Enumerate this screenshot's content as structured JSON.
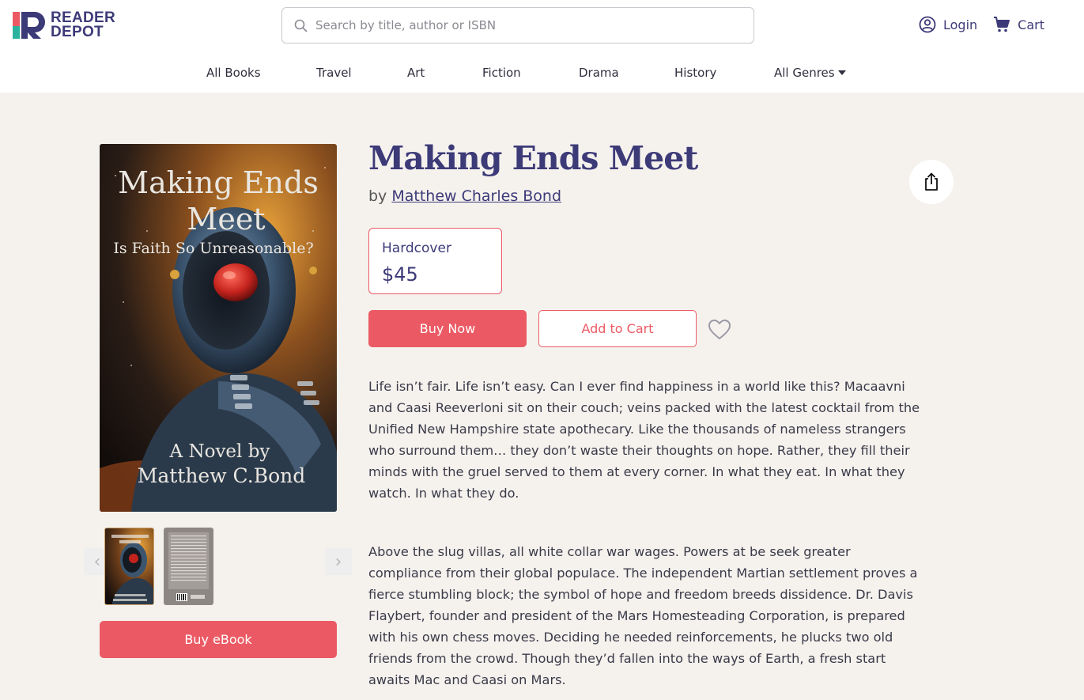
{
  "brand": {
    "line1": "READER",
    "line2": "DEPOT",
    "colors": {
      "primary": "#3d3a78",
      "accent": "#eb5a64",
      "green": "#2bb3a0"
    }
  },
  "search": {
    "placeholder": "Search by title, author or ISBN",
    "value": ""
  },
  "header_actions": {
    "login_label": "Login",
    "cart_label": "Cart"
  },
  "nav": {
    "items": [
      {
        "label": "All Books"
      },
      {
        "label": "Travel"
      },
      {
        "label": "Art"
      },
      {
        "label": "Fiction"
      },
      {
        "label": "Drama"
      },
      {
        "label": "History"
      },
      {
        "label": "All Genres",
        "dropdown": true
      }
    ]
  },
  "book": {
    "title": "Making Ends Meet",
    "by_prefix": "by",
    "author": "Matthew Charles Bond",
    "cover": {
      "title_line1": "Making Ends",
      "title_line2": "Meet",
      "subtitle": "Is Faith So Unreasonable?",
      "novel_by": "A Novel by",
      "author_name": "Matthew C.Bond"
    },
    "format": {
      "name": "Hardcover",
      "price": "$45"
    },
    "description": [
      "Life isn’t fair. Life isn’t easy. Can I ever find happiness in a world like this? Macaavni and Caasi Reeverloni sit on their couch; veins packed with the latest cocktail from the Unified New Hampshire state apothecary. Like the thousands of nameless strangers who surround them… they don’t waste their thoughts on hope. Rather, they fill their minds with the gruel served to them at every corner. In what they eat. In what they watch. In what they do.",
      "Above the slug villas, all white collar war wages. Powers at be seek greater compliance from their global populace. The independent Martian settlement proves a fierce stumbling block; the symbol of hope and freedom breeds dissidence. Dr. Davis Flaybert, founder and president of the Mars Homesteading Corporation, is prepared with his own chess moves. Deciding he needed reinforcements, he plucks two old friends from the crowd. Though they’d fallen into the ways of Earth, a fresh start awaits Mac and Caasi on Mars."
    ]
  },
  "actions": {
    "buy_now": "Buy Now",
    "add_to_cart": "Add to Cart",
    "buy_ebook": "Buy eBook"
  },
  "icons": {
    "search": "search-icon",
    "login": "user-circle-icon",
    "cart": "cart-icon",
    "share": "share-icon",
    "wishlist": "heart-icon",
    "prev": "chevron-left-icon",
    "next": "chevron-right-icon"
  }
}
